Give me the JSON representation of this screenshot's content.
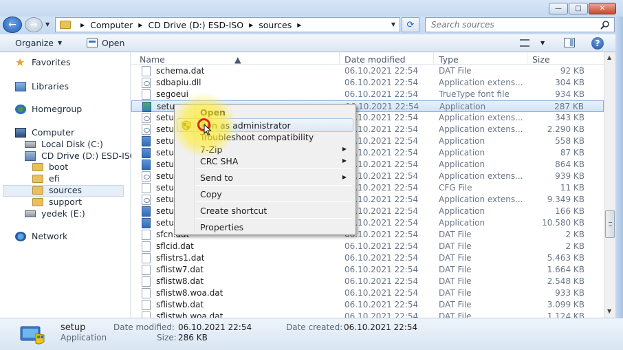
{
  "window": {
    "minimize_label": "—",
    "maximize_label": "□",
    "close_label": "✕"
  },
  "nav": {
    "back_label": "←",
    "forward_label": "→",
    "refresh_label": "⟳"
  },
  "address": {
    "crumbs": [
      "Computer",
      "CD Drive (D:) ESD-ISO",
      "sources"
    ]
  },
  "search": {
    "placeholder": "Search sources"
  },
  "toolbar": {
    "organize_label": "Organize",
    "open_label": "Open",
    "help_label": "?"
  },
  "sidebar": {
    "items": [
      {
        "label": "Favorites",
        "icon": "star-icon"
      },
      {
        "label": "Libraries",
        "icon": "library-icon"
      },
      {
        "label": "Homegroup",
        "icon": "homegroup-icon"
      },
      {
        "label": "Computer",
        "icon": "computer-icon"
      },
      {
        "label": "Local Disk (C:)",
        "icon": "disk-icon"
      },
      {
        "label": "CD Drive (D:) ESD-ISO",
        "icon": "cd-drive-icon"
      },
      {
        "label": "boot",
        "icon": "folder-icon"
      },
      {
        "label": "efi",
        "icon": "folder-icon"
      },
      {
        "label": "sources",
        "icon": "folder-icon"
      },
      {
        "label": "support",
        "icon": "folder-icon"
      },
      {
        "label": "yedek (E:)",
        "icon": "disk-icon"
      },
      {
        "label": "Network",
        "icon": "network-icon"
      }
    ]
  },
  "columns": {
    "name": "Name",
    "date": "Date modified",
    "type": "Type",
    "size": "Size"
  },
  "files": [
    {
      "name": "schema.dat",
      "date": "06.10.2021 22:54",
      "type": "DAT File",
      "size": "92 KB"
    },
    {
      "name": "sdbapiu.dll",
      "date": "06.10.2021 22:54",
      "type": "Application extens...",
      "size": "304 KB"
    },
    {
      "name": "segoeui",
      "date": "06.10.2021 22:54",
      "type": "TrueType font file",
      "size": "934 KB"
    },
    {
      "name": "setu",
      "date": "06.10.2021 22:54",
      "type": "Application",
      "size": "287 KB"
    },
    {
      "name": "setu",
      "date": "06.10.2021 22:54",
      "type": "Application extens...",
      "size": "343 KB"
    },
    {
      "name": "setu",
      "date": "06.10.2021 22:54",
      "type": "Application extens...",
      "size": "2.290 KB"
    },
    {
      "name": "setu",
      "date": "06.10.2021 22:54",
      "type": "Application",
      "size": "558 KB"
    },
    {
      "name": "setu",
      "date": "06.10.2021 22:54",
      "type": "Application",
      "size": "87 KB"
    },
    {
      "name": "setu",
      "date": "06.10.2021 22:54",
      "type": "Application",
      "size": "864 KB"
    },
    {
      "name": "setu",
      "date": "06.10.2021 22:54",
      "type": "Application extens...",
      "size": "939 KB"
    },
    {
      "name": "setu",
      "date": "06.10.2021 22:54",
      "type": "CFG File",
      "size": "11 KB"
    },
    {
      "name": "setu",
      "date": "06.10.2021 22:54",
      "type": "Application extens...",
      "size": "9.349 KB"
    },
    {
      "name": "setu",
      "date": "06.10.2021 22:54",
      "type": "Application",
      "size": "166 KB"
    },
    {
      "name": "setu",
      "date": "06.10.2021 22:54",
      "type": "Application",
      "size": "10.580 KB"
    },
    {
      "name": "sfcn.dat",
      "date": "06.10.2021 22:54",
      "type": "DAT File",
      "size": "2 KB"
    },
    {
      "name": "sflcid.dat",
      "date": "06.10.2021 22:54",
      "type": "DAT File",
      "size": "2 KB"
    },
    {
      "name": "sflistrs1.dat",
      "date": "06.10.2021 22:54",
      "type": "DAT File",
      "size": "5.463 KB"
    },
    {
      "name": "sflistw7.dat",
      "date": "06.10.2021 22:54",
      "type": "DAT File",
      "size": "1.664 KB"
    },
    {
      "name": "sflistw8.dat",
      "date": "06.10.2021 22:54",
      "type": "DAT File",
      "size": "2.548 KB"
    },
    {
      "name": "sflistw8.woa.dat",
      "date": "06.10.2021 22:54",
      "type": "DAT File",
      "size": "933 KB"
    },
    {
      "name": "sflistwb.dat",
      "date": "06.10.2021 22:54",
      "type": "DAT File",
      "size": "3.099 KB"
    },
    {
      "name": "sflistwb.woa.dat",
      "date": "06.10.2021 22:54",
      "type": "DAT File",
      "size": "1.124 KB"
    }
  ],
  "context_menu": {
    "items": [
      "Open",
      "Run as administrator",
      "Troubleshoot compatibility",
      "7-Zip",
      "CRC SHA",
      "Send to",
      "Copy",
      "Create shortcut",
      "Properties"
    ]
  },
  "details": {
    "name": "setup",
    "type": "Application",
    "modified_label": "Date modified:",
    "modified_value": "06.10.2021 22:54",
    "created_label": "Date created:",
    "created_value": "06.10.2021 22:54",
    "size_label": "Size:",
    "size_value": "286 KB"
  },
  "colors": {
    "selection": "#d4e4f7",
    "highlight_yellow": "#ffec32",
    "annotation_red": "#e02020"
  }
}
